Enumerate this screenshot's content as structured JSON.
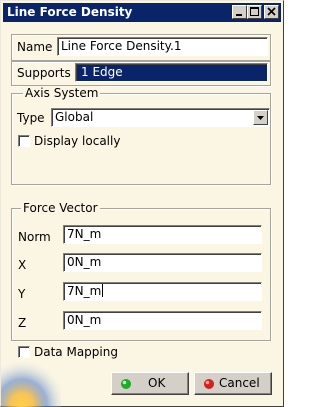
{
  "window": {
    "title": "Line Force Density"
  },
  "name_field": {
    "label": "Name",
    "value": "Line Force Density.1"
  },
  "supports_field": {
    "label": "Supports",
    "value": "1 Edge"
  },
  "axis_system": {
    "group_title": "Axis System",
    "type_label": "Type",
    "type_value": "Global",
    "display_locally_label": "Display locally",
    "display_locally_checked": false
  },
  "force_vector": {
    "group_title": "Force Vector",
    "norm": {
      "label": "Norm",
      "value": "7N_m"
    },
    "x": {
      "label": "X",
      "value": "0N_m"
    },
    "y": {
      "label": "Y",
      "value": "7N_m"
    },
    "z": {
      "label": "Z",
      "value": "0N_m"
    }
  },
  "data_mapping": {
    "label": "Data Mapping",
    "checked": false
  },
  "buttons": {
    "ok_label": "OK",
    "cancel_label": "Cancel"
  },
  "colors": {
    "title_bar": "#0a246a",
    "dialog_bg": "#fbf6e4",
    "ok_dot": "#1faa2a",
    "cancel_dot": "#d42020"
  }
}
